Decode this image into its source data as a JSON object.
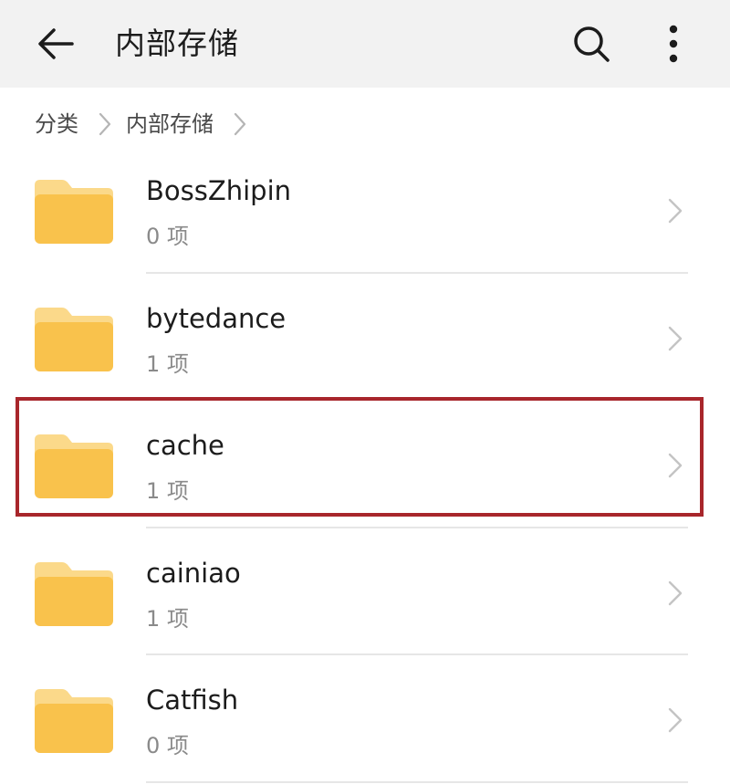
{
  "app_bar": {
    "back_icon": "arrow-left-icon",
    "title": "内部存储",
    "search_icon": "search-icon",
    "more_icon": "more-vertical-icon"
  },
  "breadcrumb": {
    "items": [
      "分类",
      "内部存储"
    ],
    "separator_icon": "chevron-right-icon"
  },
  "folders": [
    {
      "name": "BossZhipin",
      "meta": "0 项"
    },
    {
      "name": "bytedance",
      "meta": "1 项"
    },
    {
      "name": "cache",
      "meta": "1 项"
    },
    {
      "name": "cainiao",
      "meta": "1 项"
    },
    {
      "name": "Catfish",
      "meta": "0 项"
    }
  ],
  "highlighted_folder": "cache",
  "colors": {
    "app_bar_bg": "#f2f2f2",
    "folder_yellow": "#f9c24c",
    "folder_tab": "#fbd98a",
    "highlight_border": "#a8262b",
    "secondary_text": "#8a8a8a"
  }
}
